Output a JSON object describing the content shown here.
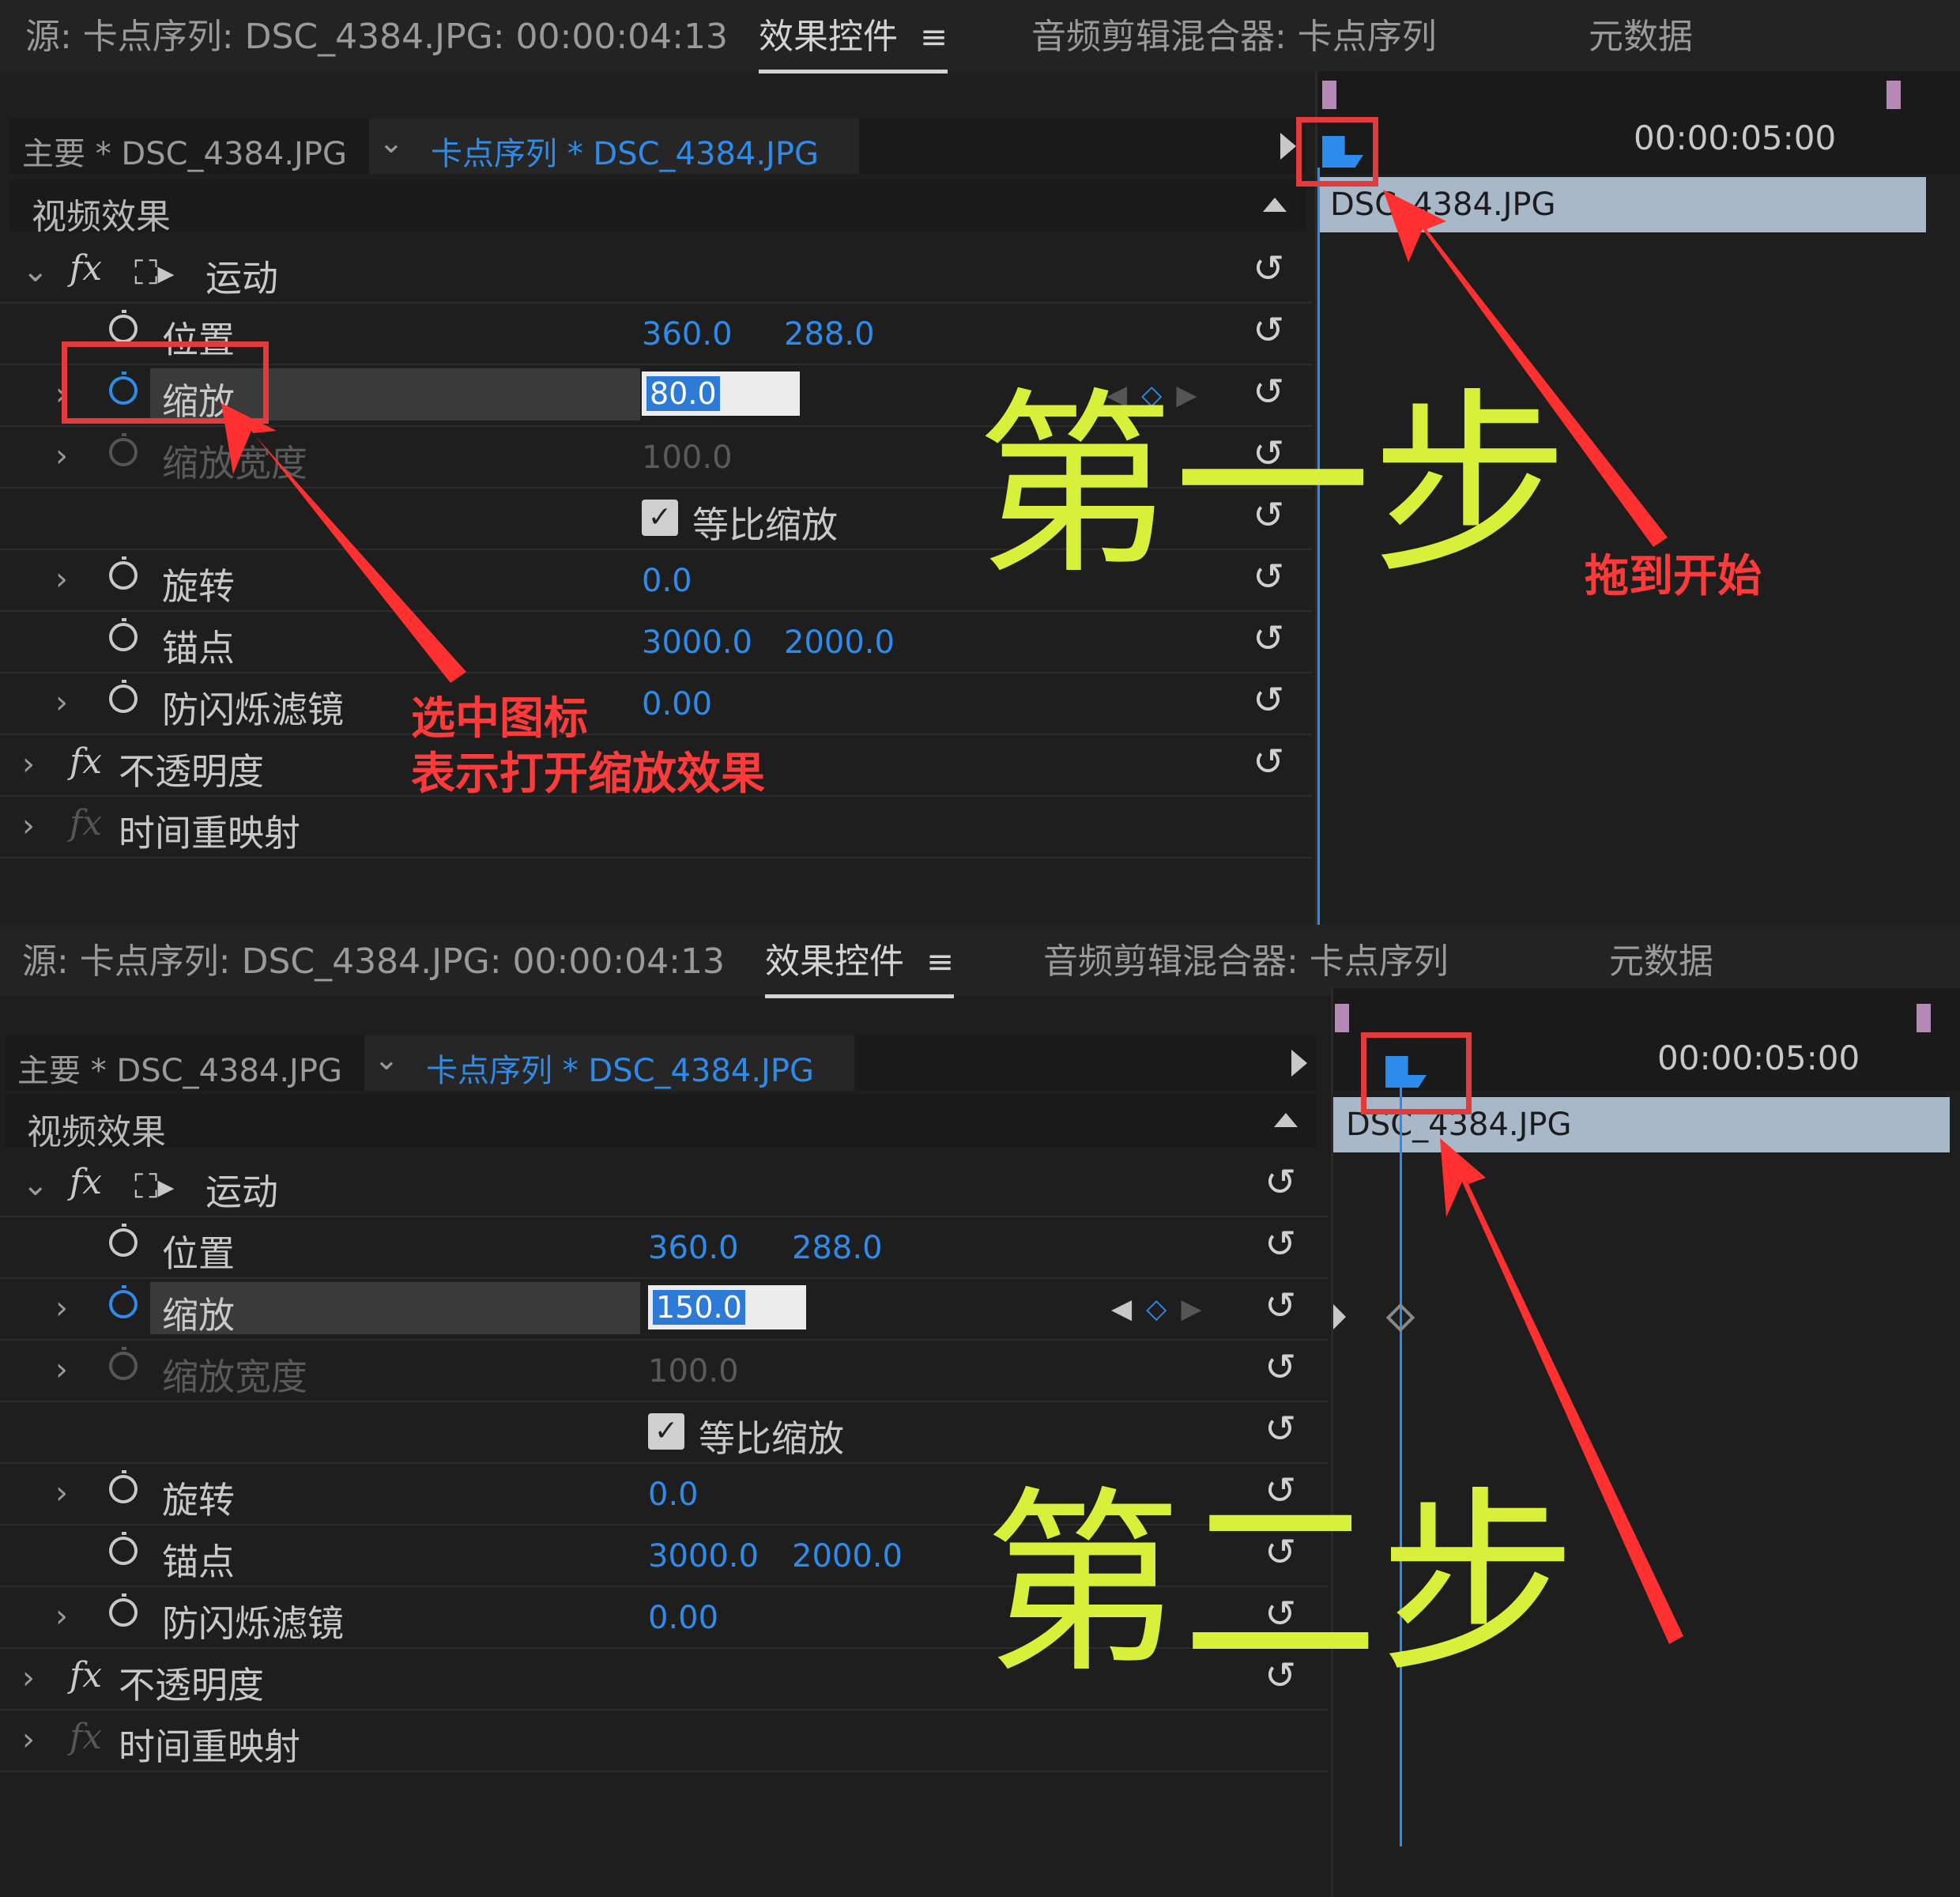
{
  "tabs": {
    "source": "源: 卡点序列: DSC_4384.JPG: 00:00:04:13",
    "effects": "效果控件",
    "menu_icon": "≡",
    "mixer": "音频剪辑混合器: 卡点序列",
    "metadata": "元数据"
  },
  "clip_bar": {
    "master": "主要 * DSC_4384.JPG",
    "sequence": "卡点序列 * DSC_4384.JPG"
  },
  "section": {
    "video_effects": "视频效果"
  },
  "effects": {
    "motion": "运动",
    "position": "位置",
    "scale": "缩放",
    "scale_width": "缩放宽度",
    "uniform_scale": "等比缩放",
    "rotation": "旋转",
    "anchor": "锚点",
    "anti_flicker": "防闪烁滤镜",
    "opacity": "不透明度",
    "time_remap": "时间重映射"
  },
  "values": {
    "position_x": "360.0",
    "position_y": "288.0",
    "scale_width": "100.0",
    "rotation": "0.0",
    "anchor_x": "3000.0",
    "anchor_y": "2000.0",
    "anti_flicker": "0.00"
  },
  "step1": {
    "scale_value": "80.0"
  },
  "step2": {
    "scale_value": "150.0"
  },
  "timeline": {
    "timecode": "00:00:05:00",
    "clip_name": "DSC_4384.JPG"
  },
  "annotations": {
    "select_icon_line1": "选中图标",
    "select_icon_line2": "表示打开缩放效果",
    "drag_to_start": "拖到开始",
    "step1": "第一步",
    "step2": "第二步"
  },
  "colors": {
    "accent_blue": "#2d8ceb",
    "annotation_red": "#e33b3b",
    "step_yellow": "#d8f03a",
    "clip_blue_gray": "#a8b8c8",
    "marker_purple": "#b589b5"
  },
  "icons": [
    "stopwatch-icon",
    "reset-icon",
    "motion-transform-icon",
    "fx-icon",
    "checkbox-checked-icon",
    "keyframe-diamond-icon",
    "playhead-icon"
  ]
}
